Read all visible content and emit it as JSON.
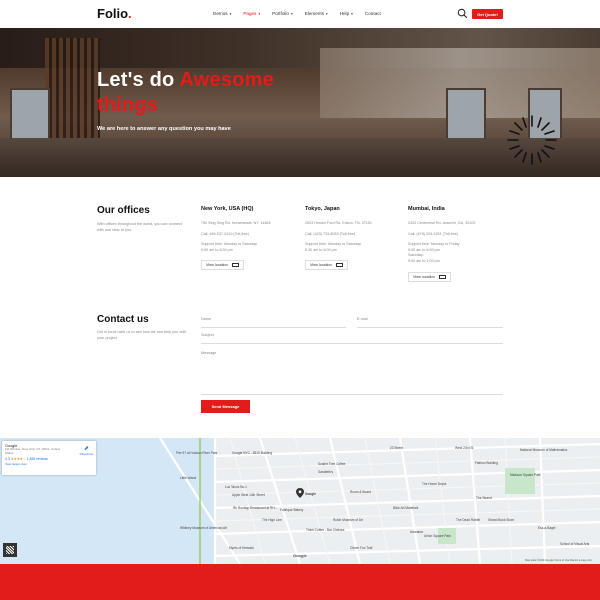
{
  "header": {
    "logo": "Folio",
    "logo_dot": ".",
    "nav": [
      {
        "label": "Demos",
        "active": false
      },
      {
        "label": "Pages",
        "active": true
      },
      {
        "label": "Portfolio",
        "active": false
      },
      {
        "label": "Elements",
        "active": false
      },
      {
        "label": "Help",
        "active": false
      },
      {
        "label": "Contact",
        "active": false
      }
    ],
    "quote_button": "Get Quote!",
    "search_icon": "search-icon"
  },
  "hero": {
    "title_part1": "Let's do ",
    "title_highlight": "Awesome",
    "title_part2": "things",
    "subtitle": "We are here to answer any question you may have"
  },
  "offices": {
    "title": "Our offices",
    "description": "With offices throughout the world, you can connect with one near to you.",
    "list": [
      {
        "name": "New York, USA (HQ)",
        "address": "750 Sing Sing Rd, Horseheads, NY, 14845",
        "phone": "Call: 469-537-2410 (Toll-free)",
        "support": "Support time: Monday to Saturday",
        "hours": "9:00 am to 8:30 pm",
        "button": "View location"
      },
      {
        "name": "Tokyo, Japan",
        "address": "2003 Hoston Ford Rd, Edson, TN, 37151",
        "phone": "Call: (423) 733-8053 (Toll-free)",
        "support": "Support time: Monday to Saturday",
        "hours": "9:30 am to 6:00 pm",
        "button": "View location"
      },
      {
        "name": "Mumbai, India",
        "address": "2453 Centennial Rd, Acworth, GA, 30102",
        "phone": "Call: (678) 324-1251 (Toll-free)",
        "support": "Support time: Monday to Friday",
        "hours": "9:00 am to 6:30 pm",
        "support2": "Saturday:",
        "hours2": "9:00 am to 1:00 pm",
        "button": "View location"
      }
    ]
  },
  "contact": {
    "title": "Contact us",
    "description": "Get in touch with us to see how we can help you with your project",
    "name_placeholder": "Name",
    "email_placeholder": "E-mail",
    "subject_placeholder": "Subject",
    "message_placeholder": "Message",
    "send_button": "Send Message"
  },
  "map": {
    "card_title": "Google",
    "card_address": "111 8th Ave, New York, NY 10011, United States",
    "rating": "4.3",
    "stars": "★★★★☆",
    "reviews": "1,836 reviews",
    "larger_map": "View larger map",
    "directions": "Directions",
    "pin_label": "Google",
    "logo": "Google",
    "footer": "Map data ©2023 Google   Terms of Use   Report a map error",
    "labels": [
      "Pier 57 at Hudson River Park",
      "Google NYC - 8510 Building",
      "Little Island",
      "Los Tacos No.1",
      "Apple West 14th Street",
      "Rh Rooftop Restaurant at RH...",
      "Fabrique Bakery",
      "The High Line",
      "Whitney Museum of American Art",
      "Think Coffee - Bar Chelsea",
      "Rubin Museum of Art",
      "Myers of Keswick",
      "Sarabeth's",
      "Room & Board",
      "Blick Art Materials",
      "Flatiron Building",
      "The Home Depot",
      "Union Square Park",
      "Strand Book Store",
      "The Strand",
      "National Museum of Mathematics",
      "Madison Square Park",
      "Adorama",
      "Ess-a-Bagel",
      "School of Visual Arts",
      "The Dead Rabbit",
      "Scarlet Tree Coffee",
      "23 Street",
      "West 23rd St",
      "Clever Fox Trail"
    ]
  }
}
